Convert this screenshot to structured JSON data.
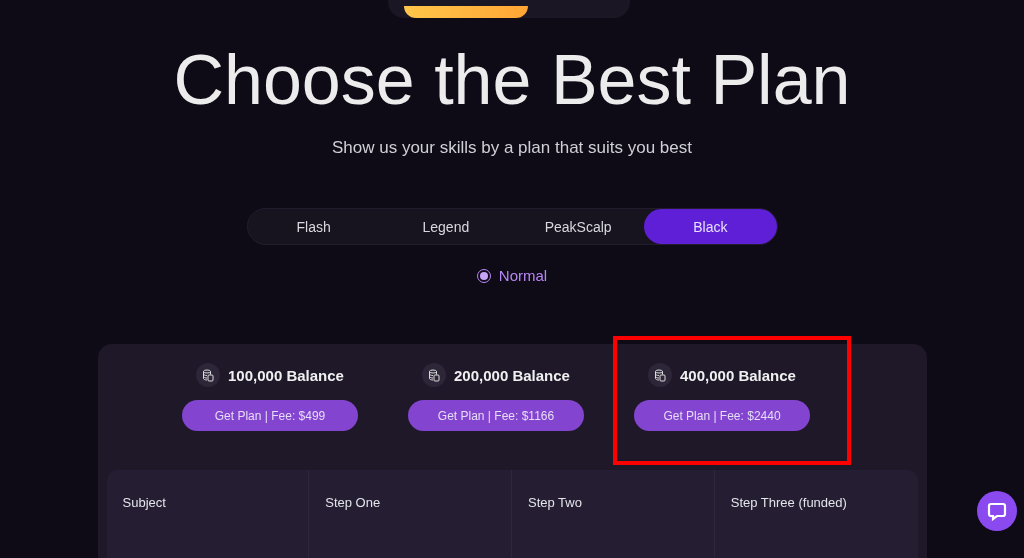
{
  "title": "Choose the Best Plan",
  "subtitle": "Show us your skills by a plan that suits you best",
  "tabs": [
    {
      "label": "Flash",
      "selected": false
    },
    {
      "label": "Legend",
      "selected": false
    },
    {
      "label": "PeakScalp",
      "selected": false
    },
    {
      "label": "Black",
      "selected": true
    }
  ],
  "modes": [
    {
      "label": "Normal",
      "selected": true
    }
  ],
  "plans": [
    {
      "balance": "100,000 Balance",
      "button": "Get Plan | Fee: $499",
      "highlighted": false
    },
    {
      "balance": "200,000 Balance",
      "button": "Get Plan | Fee: $1166",
      "highlighted": false
    },
    {
      "balance": "400,000 Balance",
      "button": "Get Plan | Fee: $2440",
      "highlighted": true
    }
  ],
  "table": {
    "columns": [
      "Subject",
      "Step One",
      "Step Two",
      "Step Three (funded)"
    ]
  }
}
